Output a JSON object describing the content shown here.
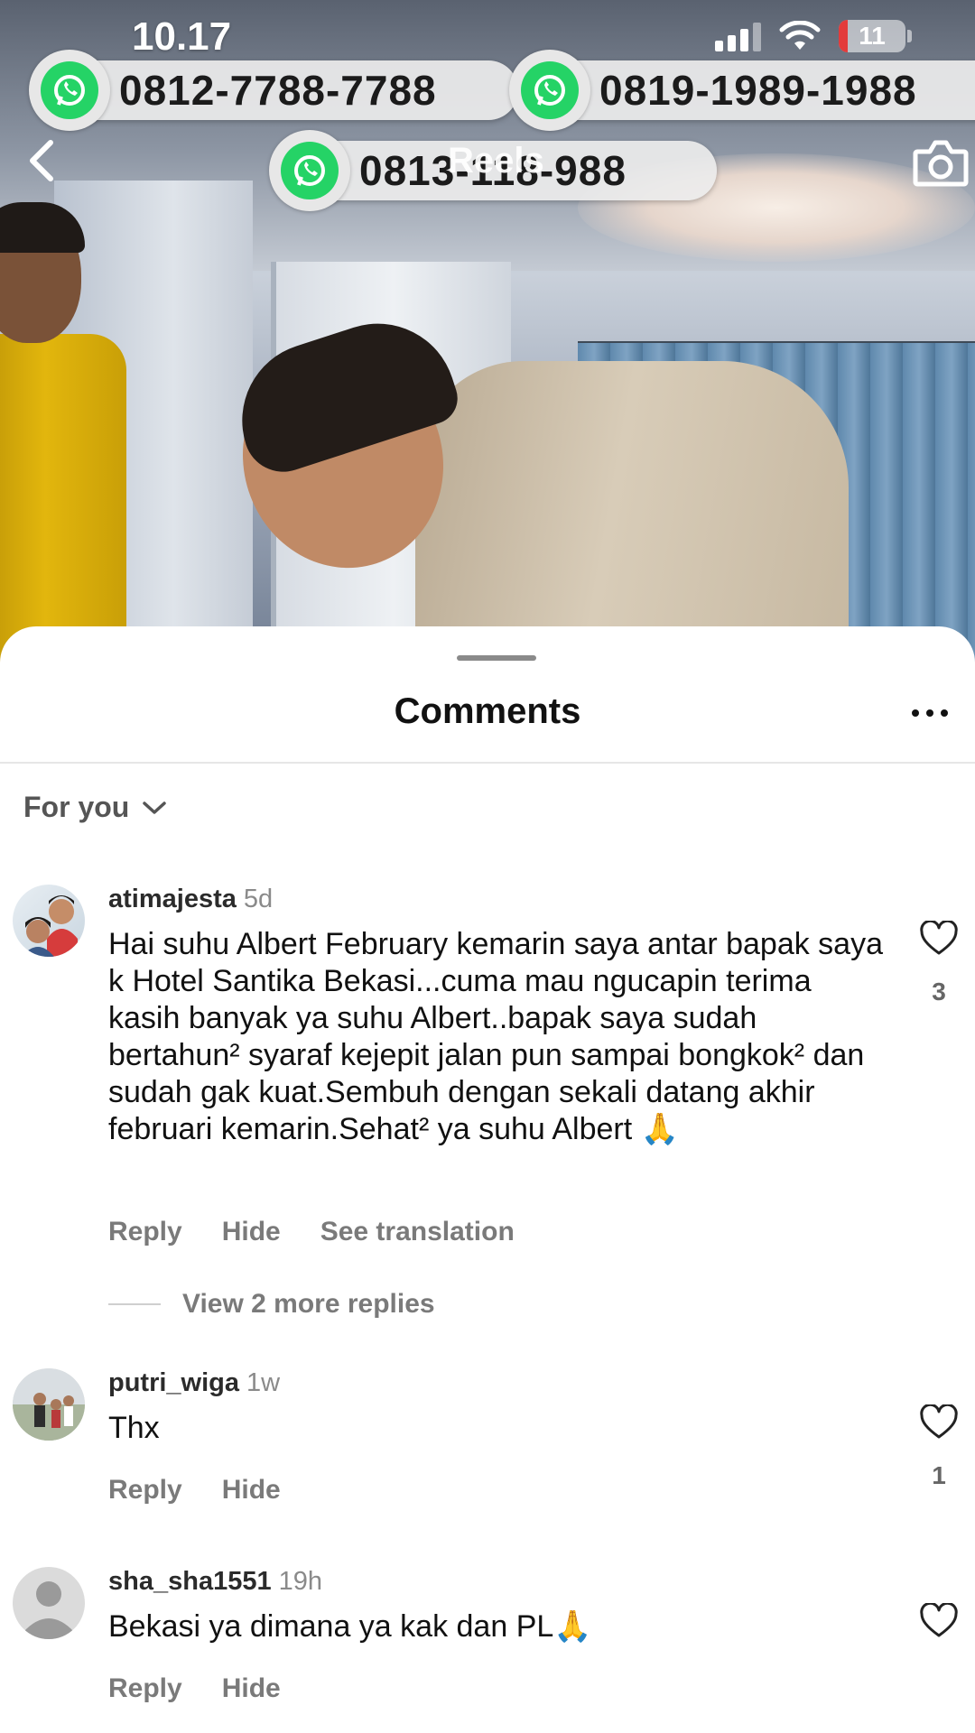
{
  "status_bar": {
    "time": "10.17",
    "battery": "11"
  },
  "overlay": {
    "phones": [
      "0812-7788-7788",
      "0819-1989-1988",
      "0813-118-988"
    ],
    "title": "Reels"
  },
  "sheet": {
    "title": "Comments",
    "filter_label": "For you"
  },
  "comments": [
    {
      "username": "atimajesta",
      "time": "5d",
      "text": "Hai suhu Albert February kemarin saya antar bapak saya k Hotel Santika Bekasi...cuma mau ngucapin terima kasih banyak ya suhu Albert..bapak saya sudah bertahun² syaraf kejepit jalan pun sampai bongkok² dan sudah gak kuat.Sembuh dengan sekali datang akhir februari kemarin.Sehat² ya suhu Albert 🙏",
      "actions": [
        "Reply",
        "Hide",
        "See translation"
      ],
      "likes": "3",
      "more_replies": "View 2 more replies"
    },
    {
      "username": "putri_wiga",
      "time": "1w",
      "text": "Thx",
      "actions": [
        "Reply",
        "Hide"
      ],
      "likes": "1"
    },
    {
      "username": "sha_sha1551",
      "time": "19h",
      "text": "Bekasi ya dimana ya kak dan PL🙏",
      "actions": [
        "Reply",
        "Hide"
      ]
    }
  ],
  "colors": {
    "whatsapp": "#25d366",
    "battery_low": "#e33b3b"
  },
  "icons": [
    "back-icon",
    "camera-icon",
    "whatsapp-icon",
    "heart-icon",
    "chevron-down-icon",
    "more-icon"
  ]
}
